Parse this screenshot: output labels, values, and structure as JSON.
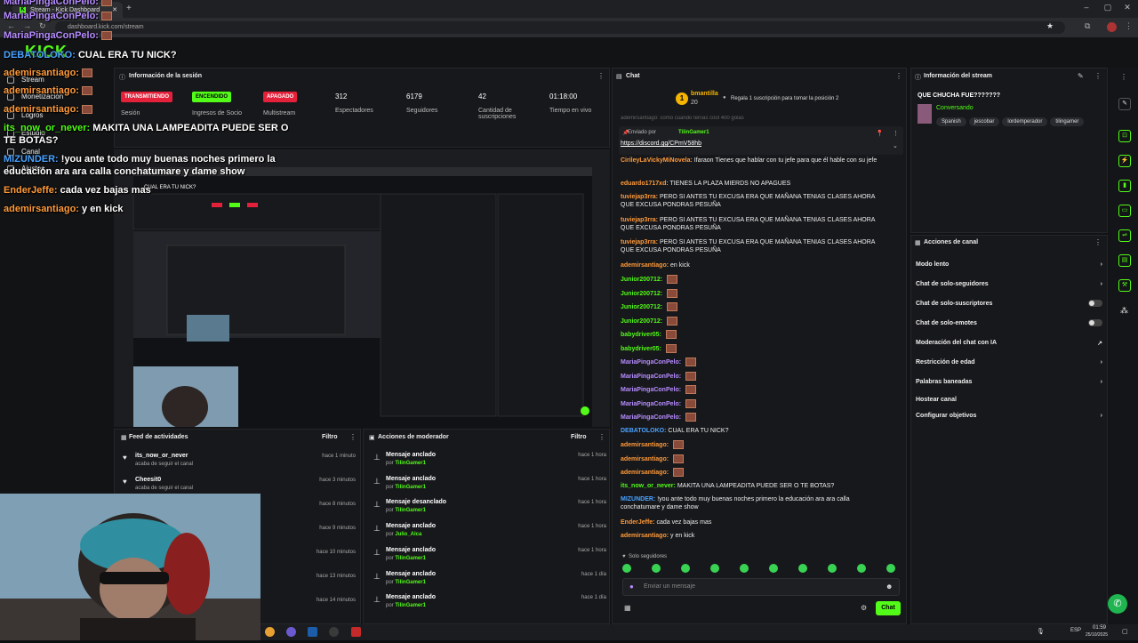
{
  "browser": {
    "tab_title": "Stream - Kick Dashboard",
    "url": "dashboard.kick.com/stream",
    "time": "01:59",
    "date": "25/10/2025",
    "lang": "ESP"
  },
  "sidebar": {
    "logo": "KICK",
    "items": [
      {
        "label": "Stream",
        "icon": "stream-icon"
      },
      {
        "label": "Monetización",
        "icon": "money-icon"
      },
      {
        "label": "Logros",
        "icon": "trophy-icon"
      },
      {
        "label": "Estudio",
        "icon": "studio-icon"
      },
      {
        "label": "Canal",
        "icon": "channel-icon"
      },
      {
        "label": "Ajustes",
        "icon": "gear-icon"
      }
    ]
  },
  "overlay_chat": [
    {
      "user": "MariaPingaConPelo:",
      "text": "",
      "color": "#b68cff",
      "emote": true
    },
    {
      "user": "MariaPingaConPelo:",
      "text": "",
      "color": "#b68cff",
      "emote": true
    },
    {
      "user": "MariaPingaConPelo:",
      "text": "",
      "color": "#b68cff",
      "emote": true
    },
    {
      "user": "DEBATOLOKO:",
      "text": "CUAL ERA TU NICK?",
      "color": "#4aa3ff",
      "emote": false
    },
    {
      "user": "ademirsantiago:",
      "text": "",
      "color": "#ff9a3a",
      "emote": true
    },
    {
      "user": "ademirsantiago:",
      "text": "",
      "color": "#ff9a3a",
      "emote": true
    },
    {
      "user": "ademirsantiago:",
      "text": "",
      "color": "#ff9a3a",
      "emote": true
    },
    {
      "user": "its_now_or_never:",
      "text": "MAKITA UNA LAMPEADITA PUEDE SER O",
      "color": "#53fc18",
      "emote": false
    },
    {
      "user": "",
      "text": "TE BOTAS?",
      "color": "#ffffff",
      "emote": false
    },
    {
      "user": "MIZUNDER:",
      "text": "!you ante todo muy buenas noches primero la",
      "color": "#4aa3ff",
      "emote": false
    },
    {
      "user": "",
      "text": "educación ara ara calla conchatumare y dame show",
      "color": "#ffffff",
      "emote": false
    },
    {
      "user": "EnderJeffe:",
      "text": "cada vez bajas mas",
      "color": "#ff9a3a",
      "emote": false
    },
    {
      "user": "ademirsantiago:",
      "text": "y en kick",
      "color": "#ff9a3a",
      "emote": false
    }
  ],
  "session": {
    "title": "Información de la sesión",
    "badges": [
      {
        "text": "TRANSMITIENDO",
        "label": "Sesión",
        "bg": "#e5203a",
        "fg": "#ffffff"
      },
      {
        "text": "ENCENDIDO",
        "label": "Ingresos de Socio",
        "bg": "#53fc18",
        "fg": "#000000"
      },
      {
        "text": "APAGADO",
        "label": "Multistream",
        "bg": "#e5203a",
        "fg": "#ffffff"
      }
    ],
    "stats": [
      {
        "value": "312",
        "label": "Espectadores"
      },
      {
        "value": "6179",
        "label": "Seguidores"
      },
      {
        "value": "42",
        "label": "Cantidad de suscripciones"
      },
      {
        "value": "01:18:00",
        "label": "Tiempo en vivo"
      }
    ]
  },
  "preview": {
    "title": "CUAL ERA TU NICK?"
  },
  "feed": {
    "title": "Feed de actividades",
    "filter": "Filtro",
    "items": [
      {
        "name": "its_now_or_never",
        "sub": "acaba de seguir el canal",
        "time": "hace 1 minuto"
      },
      {
        "name": "Cheesit0",
        "sub": "acaba de seguir el canal",
        "time": "hace 3 minutos"
      },
      {
        "name": "",
        "sub": "",
        "time": "hace 8 minutos"
      },
      {
        "name": "",
        "sub": "",
        "time": "hace 9 minutos"
      },
      {
        "name": "",
        "sub": "",
        "time": "hace 10 minutos"
      },
      {
        "name": "",
        "sub": "",
        "time": "hace 13 minutos"
      },
      {
        "name": "",
        "sub": "",
        "time": "hace 14 minutos"
      }
    ]
  },
  "mod": {
    "title": "Acciones de moderador",
    "filter": "Filtro",
    "items": [
      {
        "action": "Mensaje anclado",
        "by_prefix": "por",
        "by": "TilinGamer1",
        "time": "hace 1 hora"
      },
      {
        "action": "Mensaje anclado",
        "by_prefix": "por",
        "by": "TilinGamer1",
        "time": "hace 1 hora"
      },
      {
        "action": "Mensaje desanclado",
        "by_prefix": "por",
        "by": "TilinGamer1",
        "time": "hace 1 hora"
      },
      {
        "action": "Mensaje anclado",
        "by_prefix": "por",
        "by": "Julio_Alca",
        "time": "hace 1 hora"
      },
      {
        "action": "Mensaje anclado",
        "by_prefix": "por",
        "by": "TilinGamer1",
        "time": "hace 1 hora"
      },
      {
        "action": "Mensaje anclado",
        "by_prefix": "por",
        "by": "TilinGamer1",
        "time": "hace 1 día"
      },
      {
        "action": "Mensaje anclado",
        "by_prefix": "por",
        "by": "TilinGamer1",
        "time": "hace 1 día"
      }
    ]
  },
  "chat": {
    "title": "Chat",
    "top_gifter": {
      "rank": "1",
      "name": "bmantilla",
      "count": "20"
    },
    "gift_prompt": "Regala 1 suscripción para tomar la posición 2",
    "partial_line": "ademirsantiago: como cuando tenías cool 400 golas",
    "pinned": {
      "label": "Enviado por",
      "by": "TilinGamer1",
      "link": "https://discord.gg/CPmV58hb"
    },
    "messages": [
      {
        "user": "CirileyLaVickyMiNovela:",
        "text": "Ifaraon Tienes que hablar con tu jefe para que él hable con su jefe",
        "color": "#ff9a3a",
        "emote": false
      },
      {
        "user": "eduardo1717xd:",
        "text": "TIENES LA PLAZA MIERDS NO APAGUES",
        "color": "#ff9a3a",
        "emote": false
      },
      {
        "user": "tuviejap3rra:",
        "text": "PERO SI ANTES TU EXCUSA ERA QUE MAÑANA TENIAS CLASES AHORA QUE EXCUSA PONDRAS PESUÑA",
        "color": "#ff9a3a",
        "emote": false
      },
      {
        "user": "tuviejap3rra:",
        "text": "PERO SI ANTES TU EXCUSA ERA QUE MAÑANA TENIAS CLASES AHORA QUE EXCUSA PONDRAS PESUÑA",
        "color": "#ff9a3a",
        "emote": false
      },
      {
        "user": "tuviejap3rra:",
        "text": "PERO SI ANTES TU EXCUSA ERA QUE MAÑANA TENIAS CLASES AHORA QUE EXCUSA PONDRAS PESUÑA",
        "color": "#ff9a3a",
        "emote": false
      },
      {
        "user": "ademirsantiago:",
        "text": "en kick",
        "color": "#ff9a3a",
        "emote": false
      },
      {
        "user": "Junior200712:",
        "text": "",
        "color": "#53fc18",
        "emote": true
      },
      {
        "user": "Junior200712:",
        "text": "",
        "color": "#53fc18",
        "emote": true
      },
      {
        "user": "Junior200712:",
        "text": "",
        "color": "#53fc18",
        "emote": true
      },
      {
        "user": "Junior200712:",
        "text": "",
        "color": "#53fc18",
        "emote": true
      },
      {
        "user": "babydriver05:",
        "text": "",
        "color": "#53fc18",
        "emote": true
      },
      {
        "user": "babydriver05:",
        "text": "",
        "color": "#53fc18",
        "emote": true
      },
      {
        "user": "MariaPingaConPelo:",
        "text": "",
        "color": "#b68cff",
        "emote": true
      },
      {
        "user": "MariaPingaConPelo:",
        "text": "",
        "color": "#b68cff",
        "emote": true
      },
      {
        "user": "MariaPingaConPelo:",
        "text": "",
        "color": "#b68cff",
        "emote": true
      },
      {
        "user": "MariaPingaConPelo:",
        "text": "",
        "color": "#b68cff",
        "emote": true
      },
      {
        "user": "MariaPingaConPelo:",
        "text": "",
        "color": "#b68cff",
        "emote": true
      },
      {
        "user": "DEBATOLOKO:",
        "text": "CUAL ERA TU NICK?",
        "color": "#4aa3ff",
        "emote": false
      },
      {
        "user": "ademirsantiago:",
        "text": "",
        "color": "#ff9a3a",
        "emote": true
      },
      {
        "user": "ademirsantiago:",
        "text": "",
        "color": "#ff9a3a",
        "emote": true
      },
      {
        "user": "ademirsantiago:",
        "text": "",
        "color": "#ff9a3a",
        "emote": true
      },
      {
        "user": "its_now_or_never:",
        "text": "MAKITA UNA LAMPEADITA PUEDE SER O TE BOTAS?",
        "color": "#53fc18",
        "emote": false
      },
      {
        "user": "MIZUNDER:",
        "text": "!you ante todo muy buenas noches primero la educación ara ara calla conchatumare y dame show",
        "color": "#4aa3ff",
        "emote": false
      },
      {
        "user": "EnderJeffe:",
        "text": "cada vez bajas mas",
        "color": "#ff9a3a",
        "emote": false
      },
      {
        "user": "ademirsantiago:",
        "text": "y en kick",
        "color": "#ff9a3a",
        "emote": false
      }
    ],
    "mode": "Solo seguidores",
    "input_placeholder": "Enviar un mensaje",
    "send_label": "Chat"
  },
  "stream_info": {
    "title": "Información del stream",
    "stream_title": "QUE CHUCHA FUE???????",
    "category": "Conversando",
    "tags": [
      "Spanish",
      "jescobar",
      "lordemperador",
      "tilingamer"
    ]
  },
  "channel_actions": {
    "title": "Acciones de canal",
    "items": [
      {
        "label": "Modo lento",
        "control": "chevron"
      },
      {
        "label": "Chat de solo-seguidores",
        "control": "chevron"
      },
      {
        "label": "Chat de solo-suscriptores",
        "control": "toggle"
      },
      {
        "label": "Chat de solo-emotes",
        "control": "toggle"
      },
      {
        "label": "Moderación del chat con IA",
        "control": "external"
      },
      {
        "label": "Restricción de edad",
        "control": "chevron"
      },
      {
        "label": "Palabras baneadas",
        "control": "chevron"
      },
      {
        "label": "Hostear canal",
        "control": "none"
      },
      {
        "label": "Configurar objetivos",
        "control": "chevron"
      }
    ]
  },
  "colors": {
    "accent": "#53fc18",
    "danger": "#e5203a",
    "panel": "#17181b"
  }
}
